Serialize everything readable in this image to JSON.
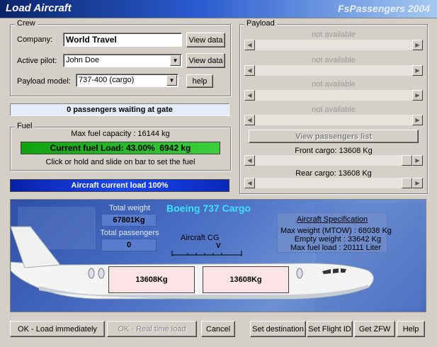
{
  "window": {
    "title": "Load Aircraft",
    "brand": "FsPassengers 2004"
  },
  "crew": {
    "legend": "Crew",
    "company_label": "Company:",
    "company_value": "World Travel",
    "pilot_label": "Active pilot:",
    "pilot_value": "John Doe",
    "payload_model_label": "Payload model:",
    "payload_model_value": "737-400 (cargo)",
    "view_data_label": "View data",
    "help_label": "help"
  },
  "passengers_waiting": "0 passengers waiting at gate",
  "fuel": {
    "legend": "Fuel",
    "max_capacity": "Max fuel capacity : 16144 kg",
    "current_load": "Current fuel Load: 43.00%  6942 kg",
    "fill_fraction": 0.43,
    "hint": "Click or hold and slide on bar to set the fuel"
  },
  "current_load": "Aircraft current load 100%",
  "payload": {
    "legend": "Payload",
    "slots": [
      "not available",
      "not available",
      "not available",
      "not available"
    ],
    "view_passengers_label": "View passengers list",
    "front_cargo": "Front cargo: 13608 Kg",
    "rear_cargo": "Rear cargo: 13608 Kg"
  },
  "aircraft": {
    "name": "Boeing 737 Cargo",
    "total_weight_label": "Total weight",
    "total_weight_value": "67801Kg",
    "total_passengers_label": "Total passengers",
    "total_passengers_value": "0",
    "cg_label": "Aircraft CG",
    "cg_marker": "V",
    "spec_title": "Aircraft Specification",
    "max_weight": "Max weight (MTOW) : 68038 Kg",
    "empty_weight": "Empty weight : 33642 Kg",
    "max_fuel": "Max fuel load : 20111 Liter",
    "front_hold": "13608Kg",
    "rear_hold": "13608Kg"
  },
  "buttons": {
    "ok_immediately": "OK - Load immediately",
    "ok_realtime": "OK - Real time load",
    "cancel": "Cancel",
    "set_destination": "Set destination",
    "set_flight_id": "Set Flight ID",
    "get_zfw": "Get ZFW",
    "help": "Help"
  },
  "colors": {
    "title_start": "#0a246a",
    "fuel_bar": "#1aa01a",
    "load_bar": "#0a2fd0",
    "passenger_bar": "#e4ecf8"
  }
}
